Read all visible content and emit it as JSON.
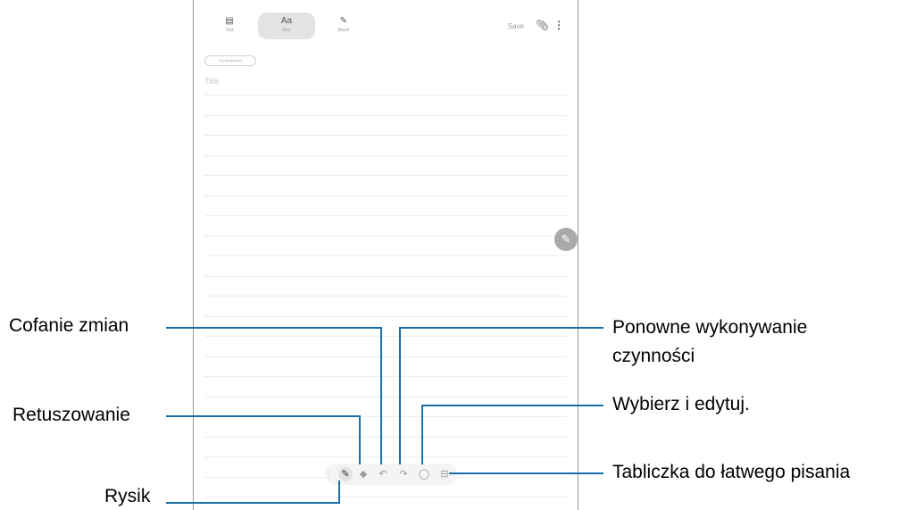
{
  "app": {
    "tabs": [
      {
        "glyph": "▤",
        "label": "Text"
      },
      {
        "glyph": "Aa",
        "label": "Pen"
      },
      {
        "glyph": "✎",
        "label": "Brush"
      }
    ],
    "save_label": "Save",
    "category_chip": "Uncategorised",
    "title_placeholder": "Title",
    "fab_icon": "pencil-icon"
  },
  "pen_toolbar": [
    {
      "name": "pen-icon",
      "glyph": "✎"
    },
    {
      "name": "eraser-icon",
      "glyph": "◆"
    },
    {
      "name": "undo-icon",
      "glyph": "↶"
    },
    {
      "name": "redo-icon",
      "glyph": "↷"
    },
    {
      "name": "selection-icon",
      "glyph": "◯"
    },
    {
      "name": "writing-pad-icon",
      "glyph": "⊟"
    }
  ],
  "callouts": {
    "undo": "Cofanie zmian",
    "retouch": "Retuszowanie",
    "pen": "Rysik",
    "redo_line1": "Ponowne wykonywanie",
    "redo_line2": "czynności",
    "select": "Wybierz i edytuj.",
    "writing_pad": "Tabliczka do łatwego pisania"
  },
  "colors": {
    "leader_line": "#1b6fa8",
    "device_border": "#9a9a9a"
  }
}
